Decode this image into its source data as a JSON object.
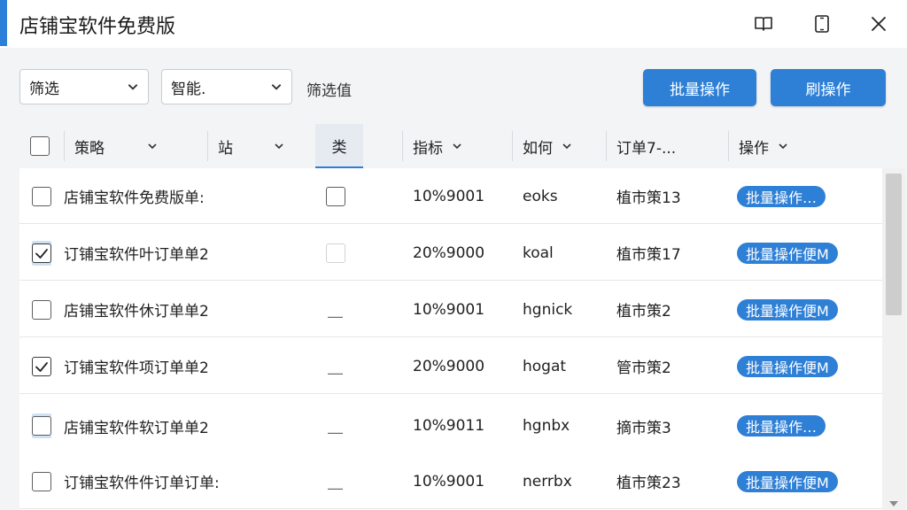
{
  "window": {
    "title": "店铺宝软件免费版",
    "accent_color": "#2e7fd6"
  },
  "toolbar": {
    "filter_dropdown": "筛选",
    "second_dropdown": "智能.",
    "status_text": "筛选值",
    "batch_button": "批量操作",
    "refresh_button": "刷操作"
  },
  "table": {
    "headers": [
      "策略",
      "站",
      "类",
      "指标",
      "如何",
      "订单7-...",
      "操作"
    ],
    "rows": [
      {
        "checked": false,
        "name": "店铺宝软件免费版单:",
        "col3": "checkbox",
        "id": "10%9001",
        "code": "eoks",
        "loc": "植市策13",
        "action": "批量操作…"
      },
      {
        "checked": true,
        "name": "订铺宝软件叶订单单2",
        "col3": "checkbox-faint",
        "id": "20%9000",
        "code": "koal",
        "loc": "植市策17",
        "action": "批量操作便M"
      },
      {
        "checked": false,
        "name": "店铺宝软件休订单单2",
        "col3": "dash",
        "id": "10%9001",
        "code": "hgnick",
        "loc": "植市策2",
        "action": "批量操作便M"
      },
      {
        "checked": true,
        "name": "订铺宝软件项订单单2",
        "col3": "dash",
        "id": "20%9000",
        "code": "hogat",
        "loc": "管市策2",
        "action": "批量操作便M"
      },
      {
        "checked": false,
        "name": "店铺宝软件软订单单2",
        "col3": "dash",
        "id": "10%9011",
        "code": "hgnbx",
        "loc": "摘市策3",
        "action": "批量操作…"
      },
      {
        "checked": false,
        "name": "订铺宝软件件订单订单:",
        "col3": "dash",
        "id": "10%9001",
        "code": "nerrbx",
        "loc": "植市策23",
        "action": "批量操作便M"
      }
    ]
  },
  "icons": [
    "book-icon",
    "tablet-icon",
    "close-icon",
    "chevron-down-icon",
    "check-icon"
  ]
}
